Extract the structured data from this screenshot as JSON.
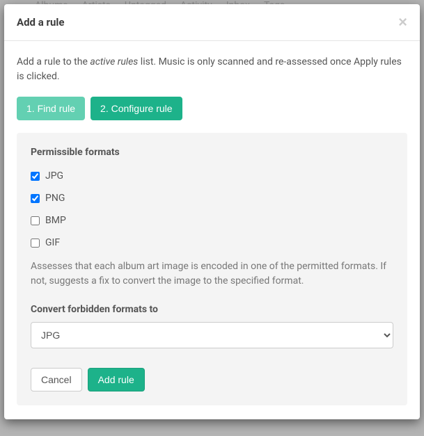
{
  "nav": {
    "items": [
      "Albums",
      "Artists",
      "Untagged",
      "Activity",
      "Inbox",
      "Tags"
    ]
  },
  "modal": {
    "title": "Add a rule",
    "intro_prefix": "Add a rule to the ",
    "intro_em": "active rules",
    "intro_suffix": " list. Music is only scanned and re-assessed once Apply rules is clicked.",
    "steps": {
      "find": "1. Find rule",
      "configure": "2. Configure rule"
    },
    "config": {
      "heading": "Permissible formats",
      "formats": [
        {
          "label": "JPG",
          "checked": true
        },
        {
          "label": "PNG",
          "checked": true
        },
        {
          "label": "BMP",
          "checked": false
        },
        {
          "label": "GIF",
          "checked": false
        }
      ],
      "description": "Assesses that each album art image is encoded in one of the permitted formats. If not, suggests a fix to convert the image to the specified format.",
      "convert_label": "Convert forbidden formats to",
      "convert_selected": "JPG"
    },
    "buttons": {
      "cancel": "Cancel",
      "add": "Add rule"
    }
  }
}
